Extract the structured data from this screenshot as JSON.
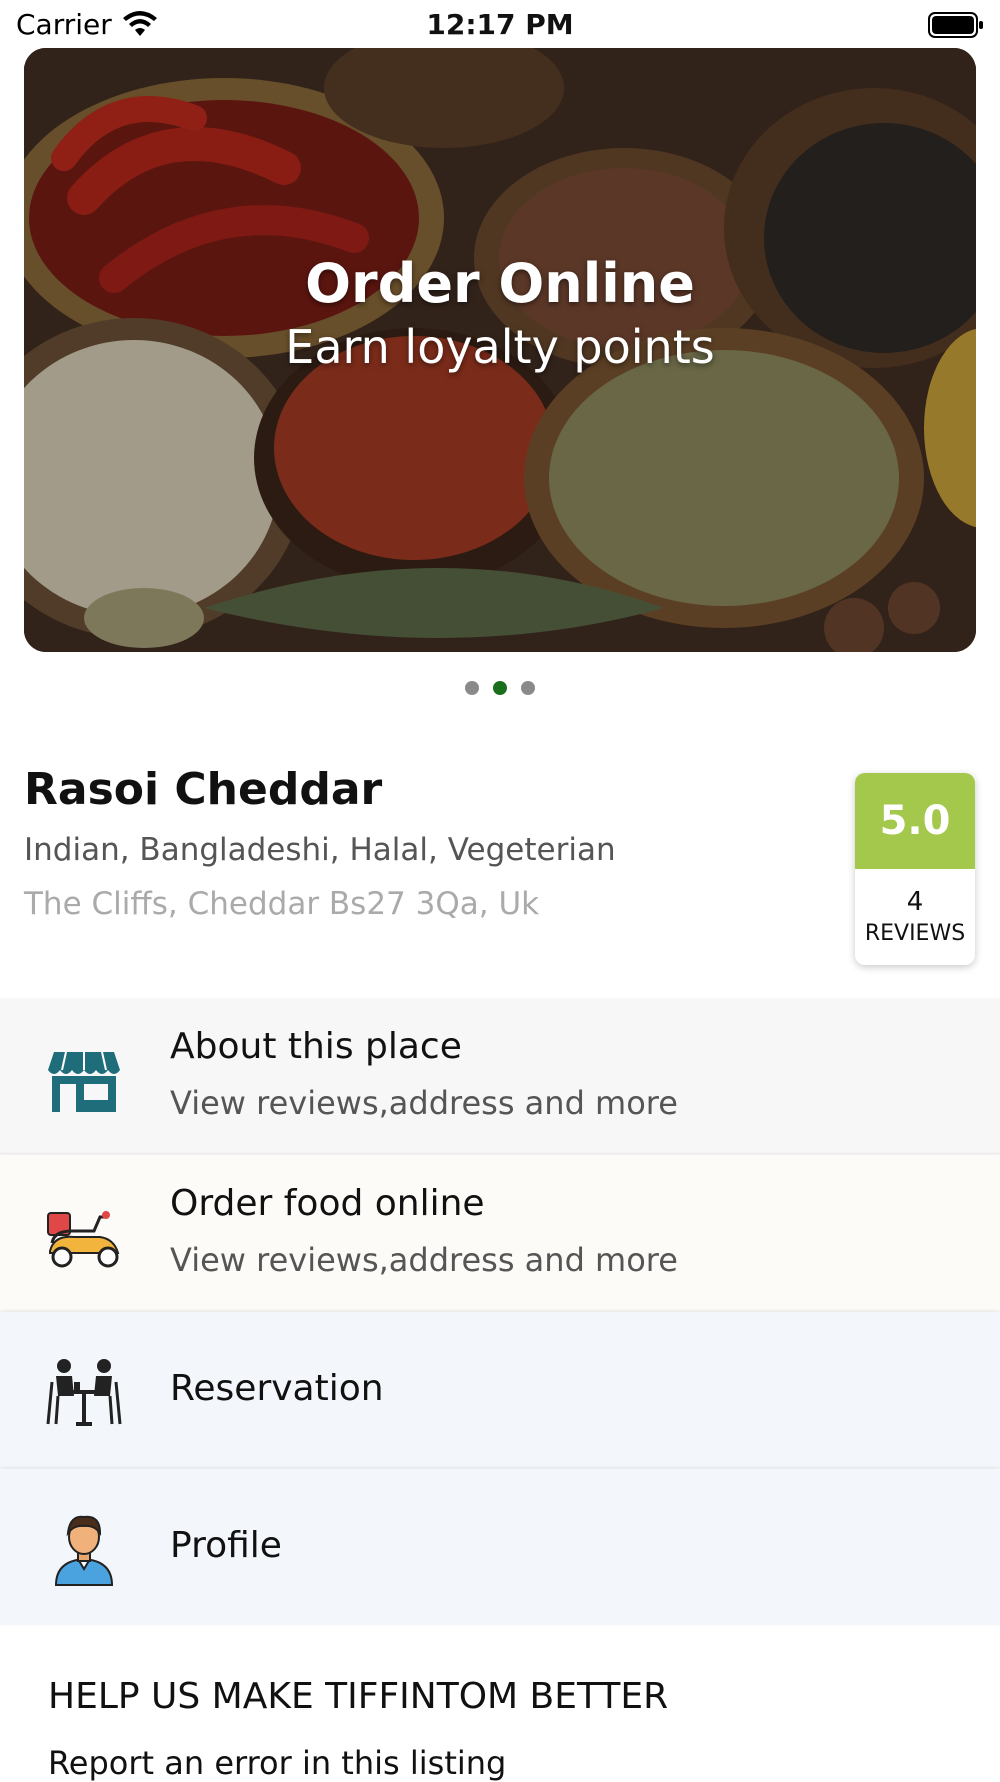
{
  "status_bar": {
    "carrier": "Carrier",
    "time": "12:17 PM"
  },
  "banner": {
    "title": "Order Online",
    "subtitle": "Earn loyalty points",
    "page_count": 3,
    "active_page": 2
  },
  "restaurant": {
    "name": "Rasoi Cheddar",
    "cuisines": "Indian, Bangladeshi, Halal, Vegeterian",
    "address": "The Cliffs, Cheddar Bs27 3Qa, Uk",
    "rating": "5.0",
    "review_count": "4",
    "review_label": "REVIEWS"
  },
  "menu": {
    "about": {
      "title": "About this place",
      "subtitle": "View reviews,address and more",
      "icon": "store-icon"
    },
    "order": {
      "title": "Order food online",
      "subtitle": "View reviews,address and more",
      "icon": "scooter-icon"
    },
    "reservation": {
      "title": "Reservation",
      "icon": "dining-people-icon"
    },
    "profile": {
      "title": "Profile",
      "icon": "person-icon"
    }
  },
  "help": {
    "title": "HELP US MAKE TIFFINTOM BETTER",
    "link": "Report an error in this listing"
  },
  "colors": {
    "rating_bg": "#a4c84b",
    "active_dot": "#1b6e1b",
    "store_icon": "#1f6d7a"
  }
}
